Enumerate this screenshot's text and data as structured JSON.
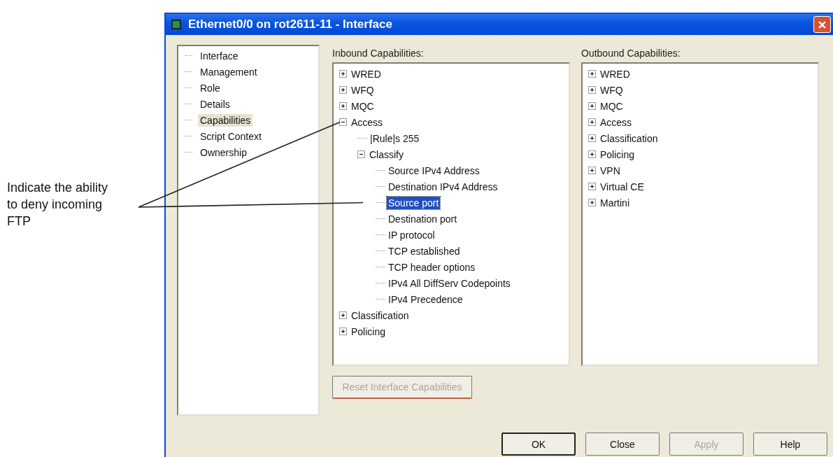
{
  "annotation": {
    "text": "Indicate the ability to deny incoming FTP"
  },
  "window": {
    "title": "Ethernet0/0 on rot2611-11 - Interface"
  },
  "nav": {
    "items": [
      {
        "label": "Interface",
        "selected": false
      },
      {
        "label": "Management",
        "selected": false
      },
      {
        "label": "Role",
        "selected": false
      },
      {
        "label": "Details",
        "selected": false
      },
      {
        "label": "Capabilities",
        "selected": true
      },
      {
        "label": "Script Context",
        "selected": false
      },
      {
        "label": "Ownership",
        "selected": false
      }
    ]
  },
  "inbound": {
    "label": "Inbound Capabilities:",
    "tree": [
      {
        "label": "WRED",
        "expanded": false,
        "selected": false
      },
      {
        "label": "WFQ",
        "expanded": false,
        "selected": false
      },
      {
        "label": "MQC",
        "expanded": false,
        "selected": false
      },
      {
        "label": "Access",
        "expanded": true,
        "selected": false,
        "children": [
          {
            "label": "|Rule|s 255",
            "selected": false
          },
          {
            "label": "Classify",
            "expanded": true,
            "selected": false,
            "children": [
              {
                "label": "Source IPv4 Address",
                "selected": false
              },
              {
                "label": "Destination IPv4 Address",
                "selected": false
              },
              {
                "label": "Source port",
                "selected": true
              },
              {
                "label": "Destination port",
                "selected": false
              },
              {
                "label": "IP protocol",
                "selected": false
              },
              {
                "label": "TCP established",
                "selected": false
              },
              {
                "label": "TCP header options",
                "selected": false
              },
              {
                "label": "IPv4 All DiffServ Codepoints",
                "selected": false
              },
              {
                "label": "IPv4 Precedence",
                "selected": false
              }
            ]
          }
        ]
      },
      {
        "label": "Classification",
        "expanded": false,
        "selected": false
      },
      {
        "label": "Policing",
        "expanded": false,
        "selected": false
      }
    ]
  },
  "outbound": {
    "label": "Outbound Capabilities:",
    "tree": [
      {
        "label": "WRED",
        "expanded": false,
        "selected": false
      },
      {
        "label": "WFQ",
        "expanded": false,
        "selected": false
      },
      {
        "label": "MQC",
        "expanded": false,
        "selected": false
      },
      {
        "label": "Access",
        "expanded": false,
        "selected": false
      },
      {
        "label": "Classification",
        "expanded": false,
        "selected": false
      },
      {
        "label": "Policing",
        "expanded": false,
        "selected": false
      },
      {
        "label": "VPN",
        "expanded": false,
        "selected": false
      },
      {
        "label": "Virtual CE",
        "expanded": false,
        "selected": false
      },
      {
        "label": "Martini",
        "expanded": false,
        "selected": false
      }
    ]
  },
  "reset_button": {
    "label": "Reset Interface Capabilities",
    "disabled": true
  },
  "buttons": [
    {
      "label": "OK",
      "default": true,
      "disabled": false
    },
    {
      "label": "Close",
      "default": false,
      "disabled": false
    },
    {
      "label": "Apply",
      "default": false,
      "disabled": true
    },
    {
      "label": "Help",
      "default": false,
      "disabled": false
    }
  ]
}
